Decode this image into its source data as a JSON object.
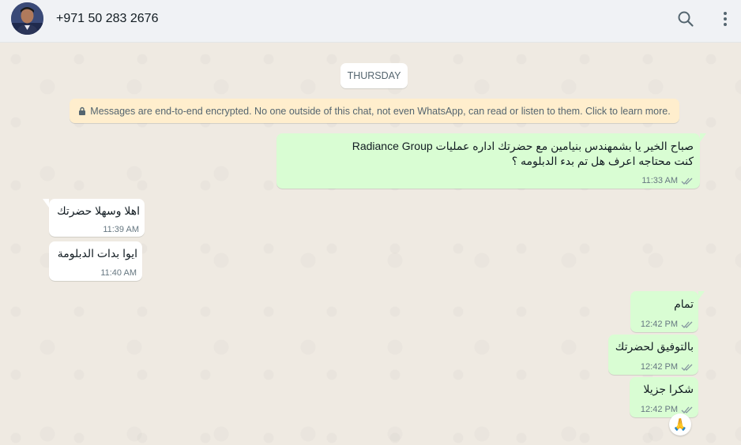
{
  "header": {
    "contact_name": "+971 50 283 2676",
    "icons": [
      "avatar",
      "search-icon",
      "menu-icon"
    ]
  },
  "chat": {
    "date_chip": "THURSDAY",
    "encryption_notice": "Messages are end-to-end encrypted. No one outside of this chat, not even WhatsApp, can read or listen to them. Click to learn more.",
    "messages": [
      {
        "direction": "outgoing",
        "lines": [
          "صباح الخير يا بشمهندس بنيامين مع حضرتك اداره عمليات Radiance Group",
          "كنت محتاجه اعرف هل تم بدء الدبلومه ؟"
        ],
        "time": "11:33 AM",
        "status": "read"
      },
      {
        "direction": "incoming",
        "text": "اهلا وسهلا حضرتك",
        "time": "11:39 AM"
      },
      {
        "direction": "incoming",
        "text": "ايوا بدات الدبلومة",
        "time": "11:40 AM"
      },
      {
        "direction": "outgoing",
        "text": "تمام",
        "time": "12:42 PM",
        "status": "read"
      },
      {
        "direction": "outgoing",
        "text": "بالتوفيق لحضرتك",
        "time": "12:42 PM",
        "status": "read"
      },
      {
        "direction": "outgoing",
        "text": "شكرا جزيلا",
        "time": "12:42 PM",
        "status": "read",
        "reaction": "🙏"
      }
    ]
  },
  "colors": {
    "header_bg": "#f0f2f5",
    "chat_bg": "#efeae2",
    "outgoing_bubble": "#d9fdd3",
    "incoming_bubble": "#ffffff",
    "encryption_bg": "#ffeecd",
    "read_tick": "#8696a0"
  }
}
